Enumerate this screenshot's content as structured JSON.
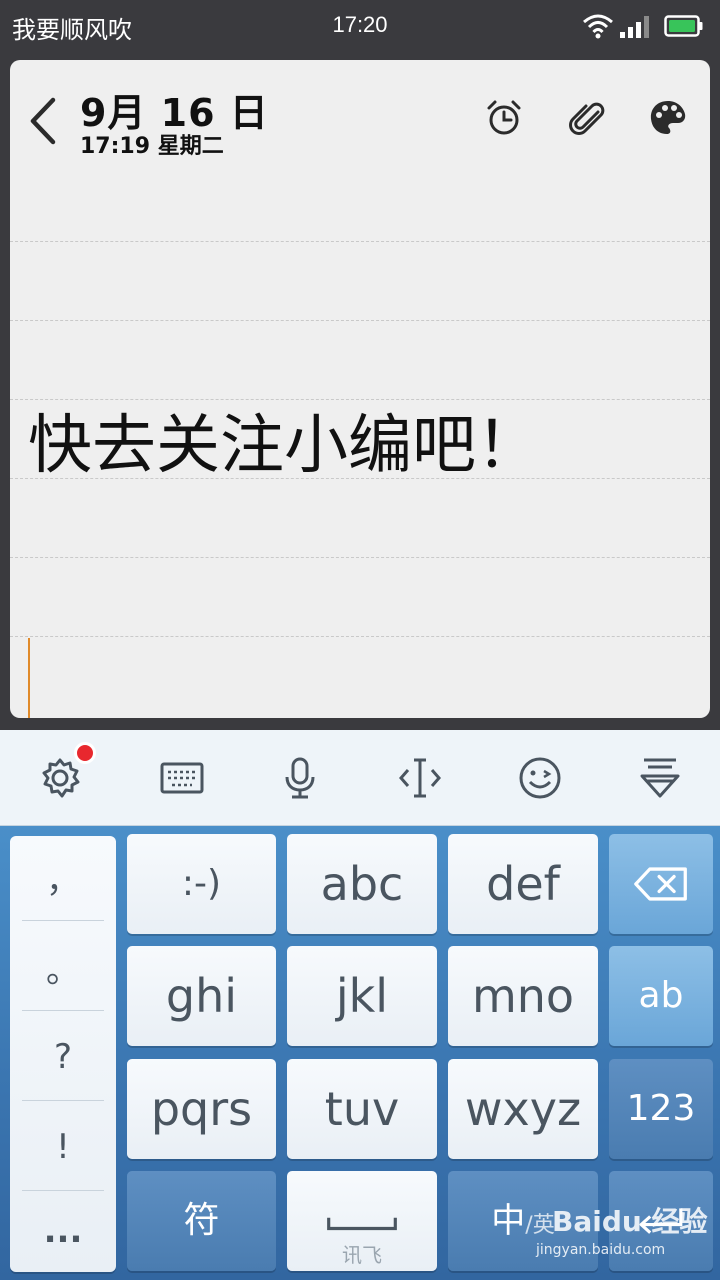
{
  "status_bar": {
    "carrier": "我要顺风吹",
    "time": "17:20",
    "icons": [
      "wifi-icon",
      "signal-icon",
      "battery-icon"
    ]
  },
  "note": {
    "date": "9月 16 日",
    "time_day": "17:19 星期二",
    "body": "快去关注小编吧！",
    "header_icons": [
      "back-icon",
      "alarm-icon",
      "paperclip-icon",
      "palette-icon"
    ]
  },
  "keyboard_toolbar": {
    "icons": [
      "settings-icon",
      "keyboard-icon",
      "microphone-icon",
      "cursor-icon",
      "emoji-icon",
      "collapse-keyboard-icon"
    ]
  },
  "keyboard": {
    "punctuation": [
      "，",
      "。",
      "?",
      "!",
      "..."
    ],
    "keys": {
      "smiley": ":-)",
      "abc": "abc",
      "def": "def",
      "ghi": "ghi",
      "jkl": "jkl",
      "mno": "mno",
      "ab": "ab",
      "pqrs": "pqrs",
      "tuv": "tuv",
      "wxyz": "wxyz",
      "num": "123",
      "symbol": "符",
      "space_hint": "讯飞",
      "lang_main": "中",
      "lang_alt": "/英"
    },
    "watermark_main": "Baidu 经验",
    "watermark_url": "jingyan.baidu.com"
  },
  "colors": {
    "note_background": "#efefef",
    "keyboard_blue": "#3b76b1",
    "cursor": "#e08a2a",
    "notification_dot": "#e8282e"
  }
}
